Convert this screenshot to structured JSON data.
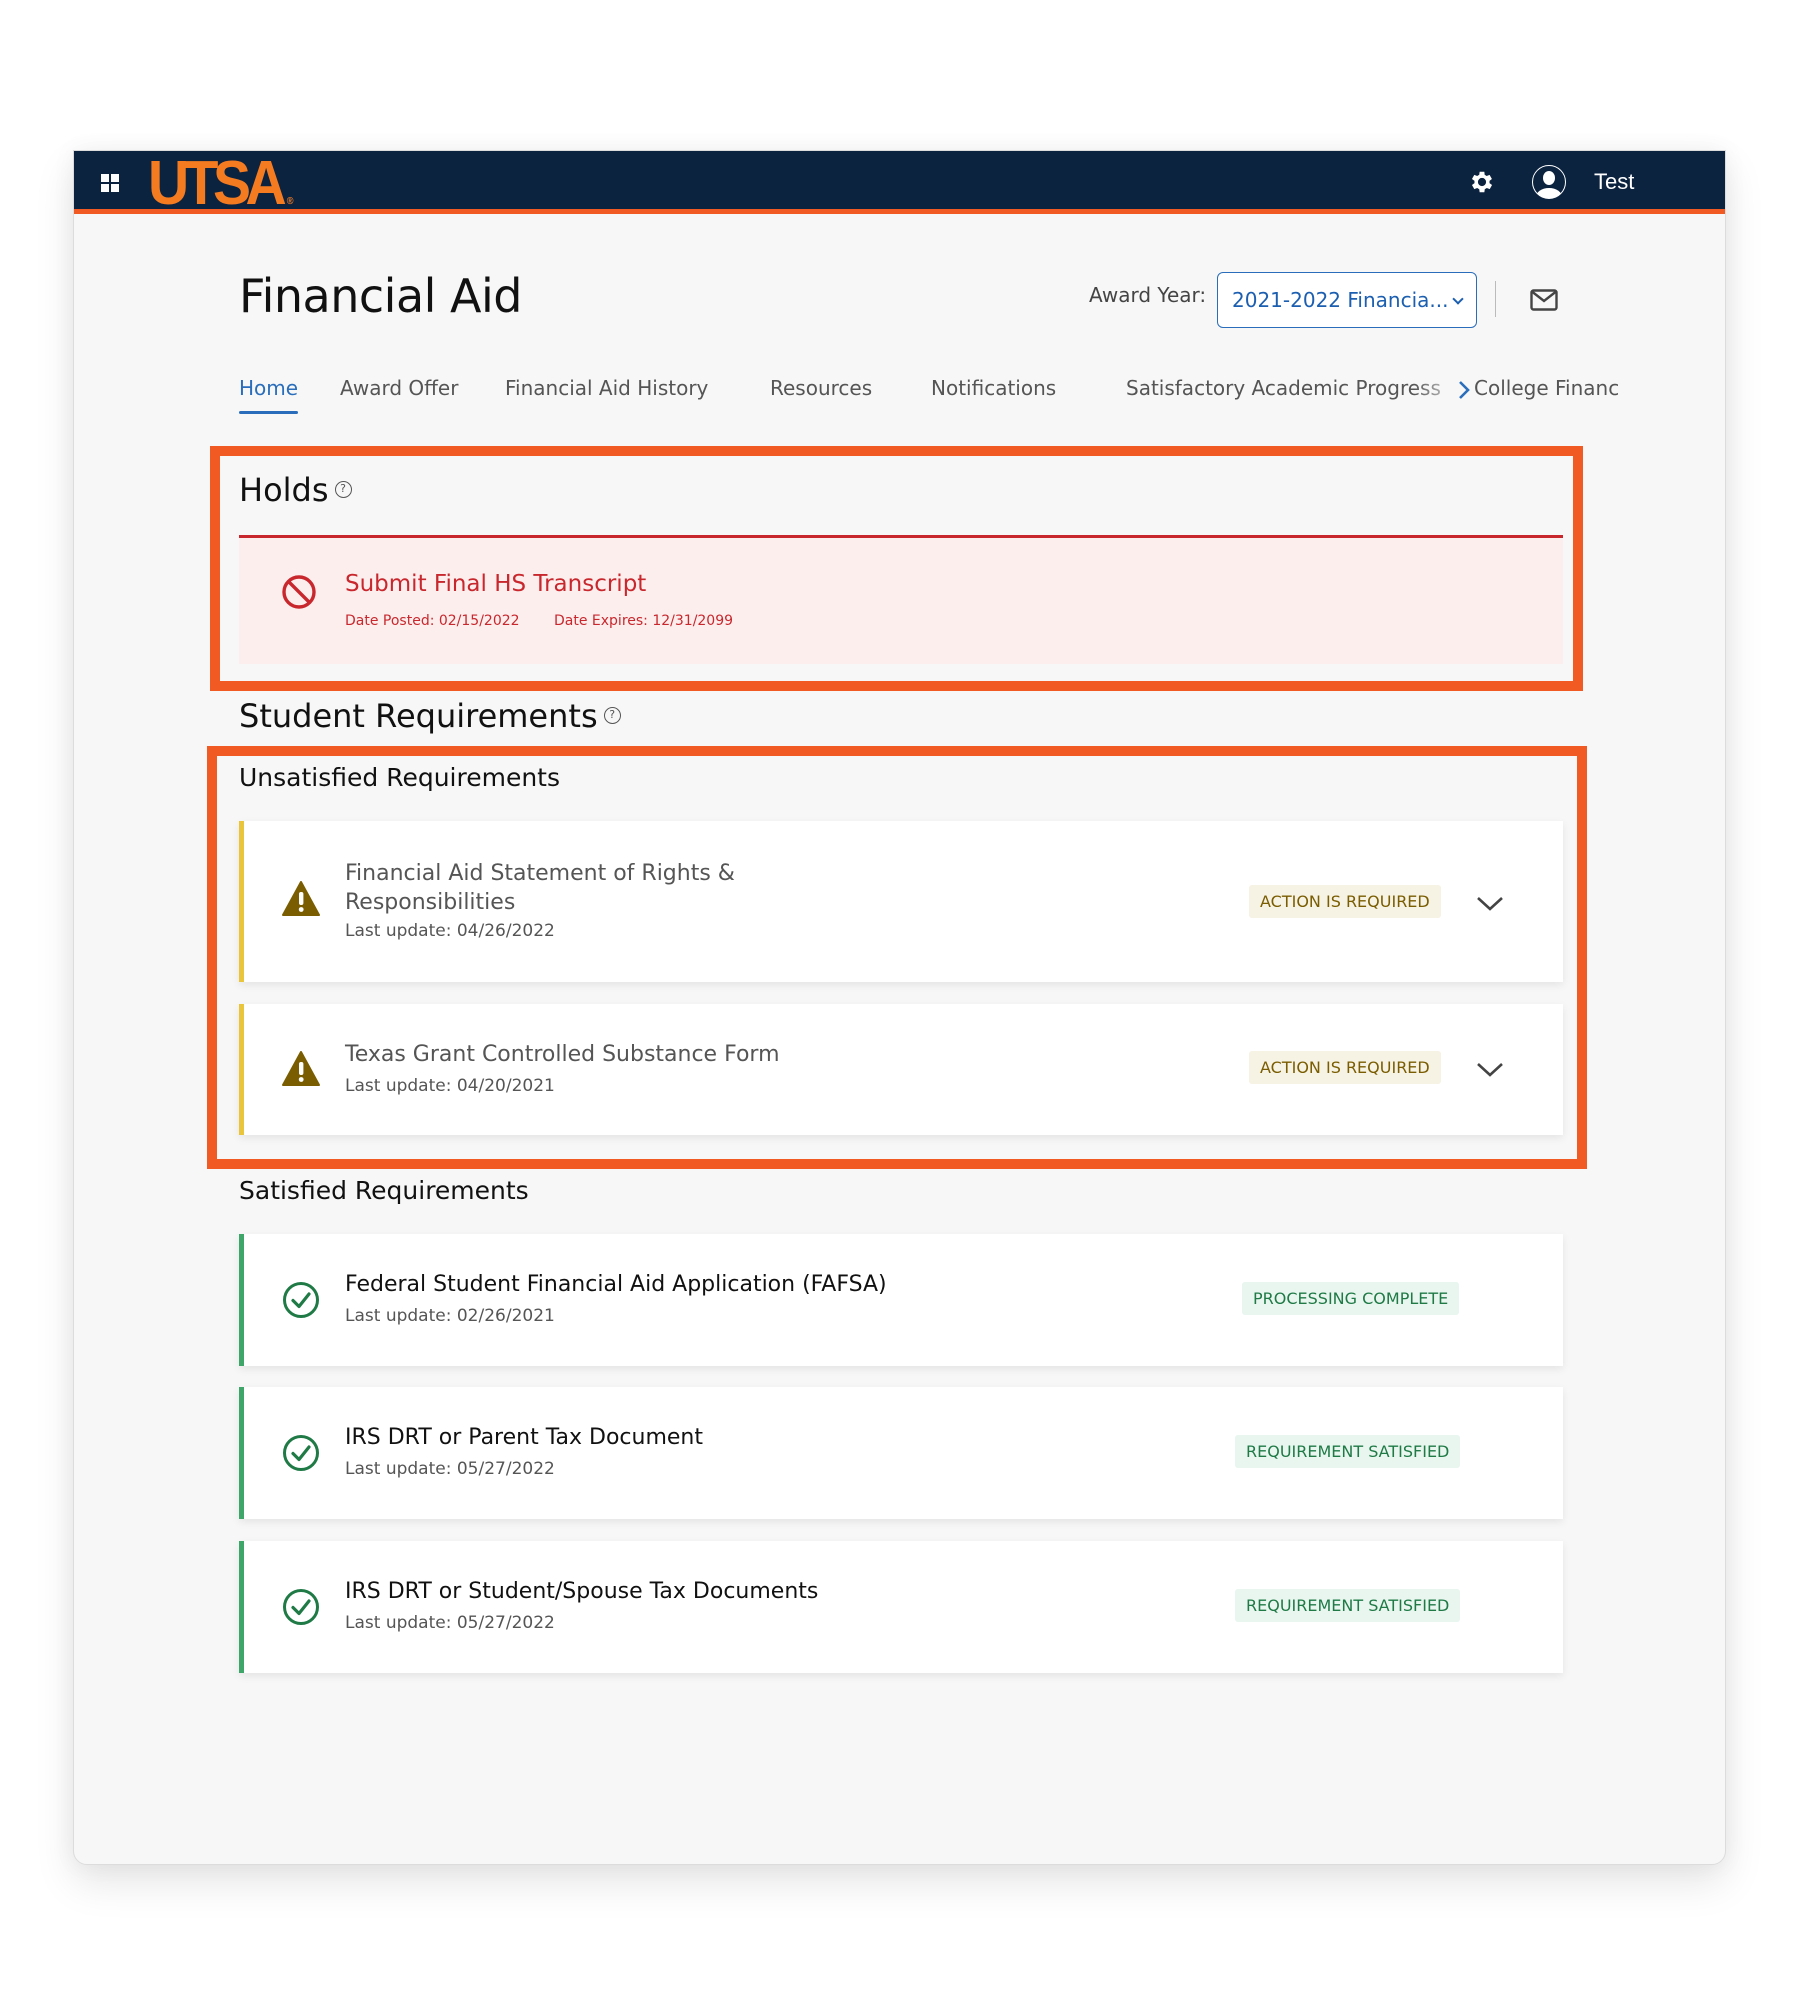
{
  "header": {
    "logo": "UTSA",
    "user_name": "Test"
  },
  "page": {
    "title": "Financial Aid",
    "award_year_label": "Award Year:",
    "award_year_value": "2021-2022 Financia..."
  },
  "nav": {
    "tabs": [
      {
        "label": "Home",
        "active": true
      },
      {
        "label": "Award Offer"
      },
      {
        "label": "Financial Aid History"
      },
      {
        "label": "Resources"
      },
      {
        "label": "Notifications"
      },
      {
        "label": "Satisfactory Academic Progress"
      },
      {
        "label": "College Financ"
      }
    ]
  },
  "holds": {
    "heading": "Holds",
    "items": [
      {
        "title": "Submit Final HS Transcript",
        "date_posted": "Date Posted: 02/15/2022",
        "date_expires": "Date Expires: 12/31/2099"
      }
    ]
  },
  "requirements": {
    "heading": "Student Requirements",
    "unsatisfied": {
      "heading": "Unsatisfied Requirements",
      "items": [
        {
          "title": "Financial Aid Statement of Rights & Responsibilities",
          "last_update": "Last update: 04/26/2022",
          "status": "ACTION IS REQUIRED"
        },
        {
          "title": "Texas Grant Controlled Substance Form",
          "last_update": "Last update: 04/20/2021",
          "status": "ACTION IS REQUIRED"
        }
      ]
    },
    "satisfied": {
      "heading": "Satisfied Requirements",
      "items": [
        {
          "title": "Federal Student Financial Aid Application (FAFSA)",
          "last_update": "Last update: 02/26/2021",
          "status": "PROCESSING COMPLETE"
        },
        {
          "title": "IRS DRT or Parent Tax Document",
          "last_update": "Last update: 05/27/2022",
          "status": "REQUIREMENT SATISFIED"
        },
        {
          "title": "IRS DRT or Student/Spouse Tax Documents",
          "last_update": "Last update: 05/27/2022",
          "status": "REQUIREMENT SATISFIED"
        }
      ]
    }
  },
  "icons": {
    "apps": "grid-icon",
    "settings": "gear-icon",
    "profile": "user-icon",
    "mail": "envelope-icon",
    "help": "?",
    "hold": "prohibited-icon",
    "warning": "warning-icon",
    "done": "check-circle-icon",
    "expand": "chevron-down-icon",
    "scroll_tabs": "chevron-right-icon"
  },
  "colors": {
    "brand_navy": "#0c2340",
    "brand_orange": "#f47b20",
    "highlight_outline": "#f15a22",
    "link_blue": "#2a6ebb",
    "hold_red": "#c8282d",
    "warning_yellow": "#e8c53a",
    "success_green": "#3fa66a"
  }
}
